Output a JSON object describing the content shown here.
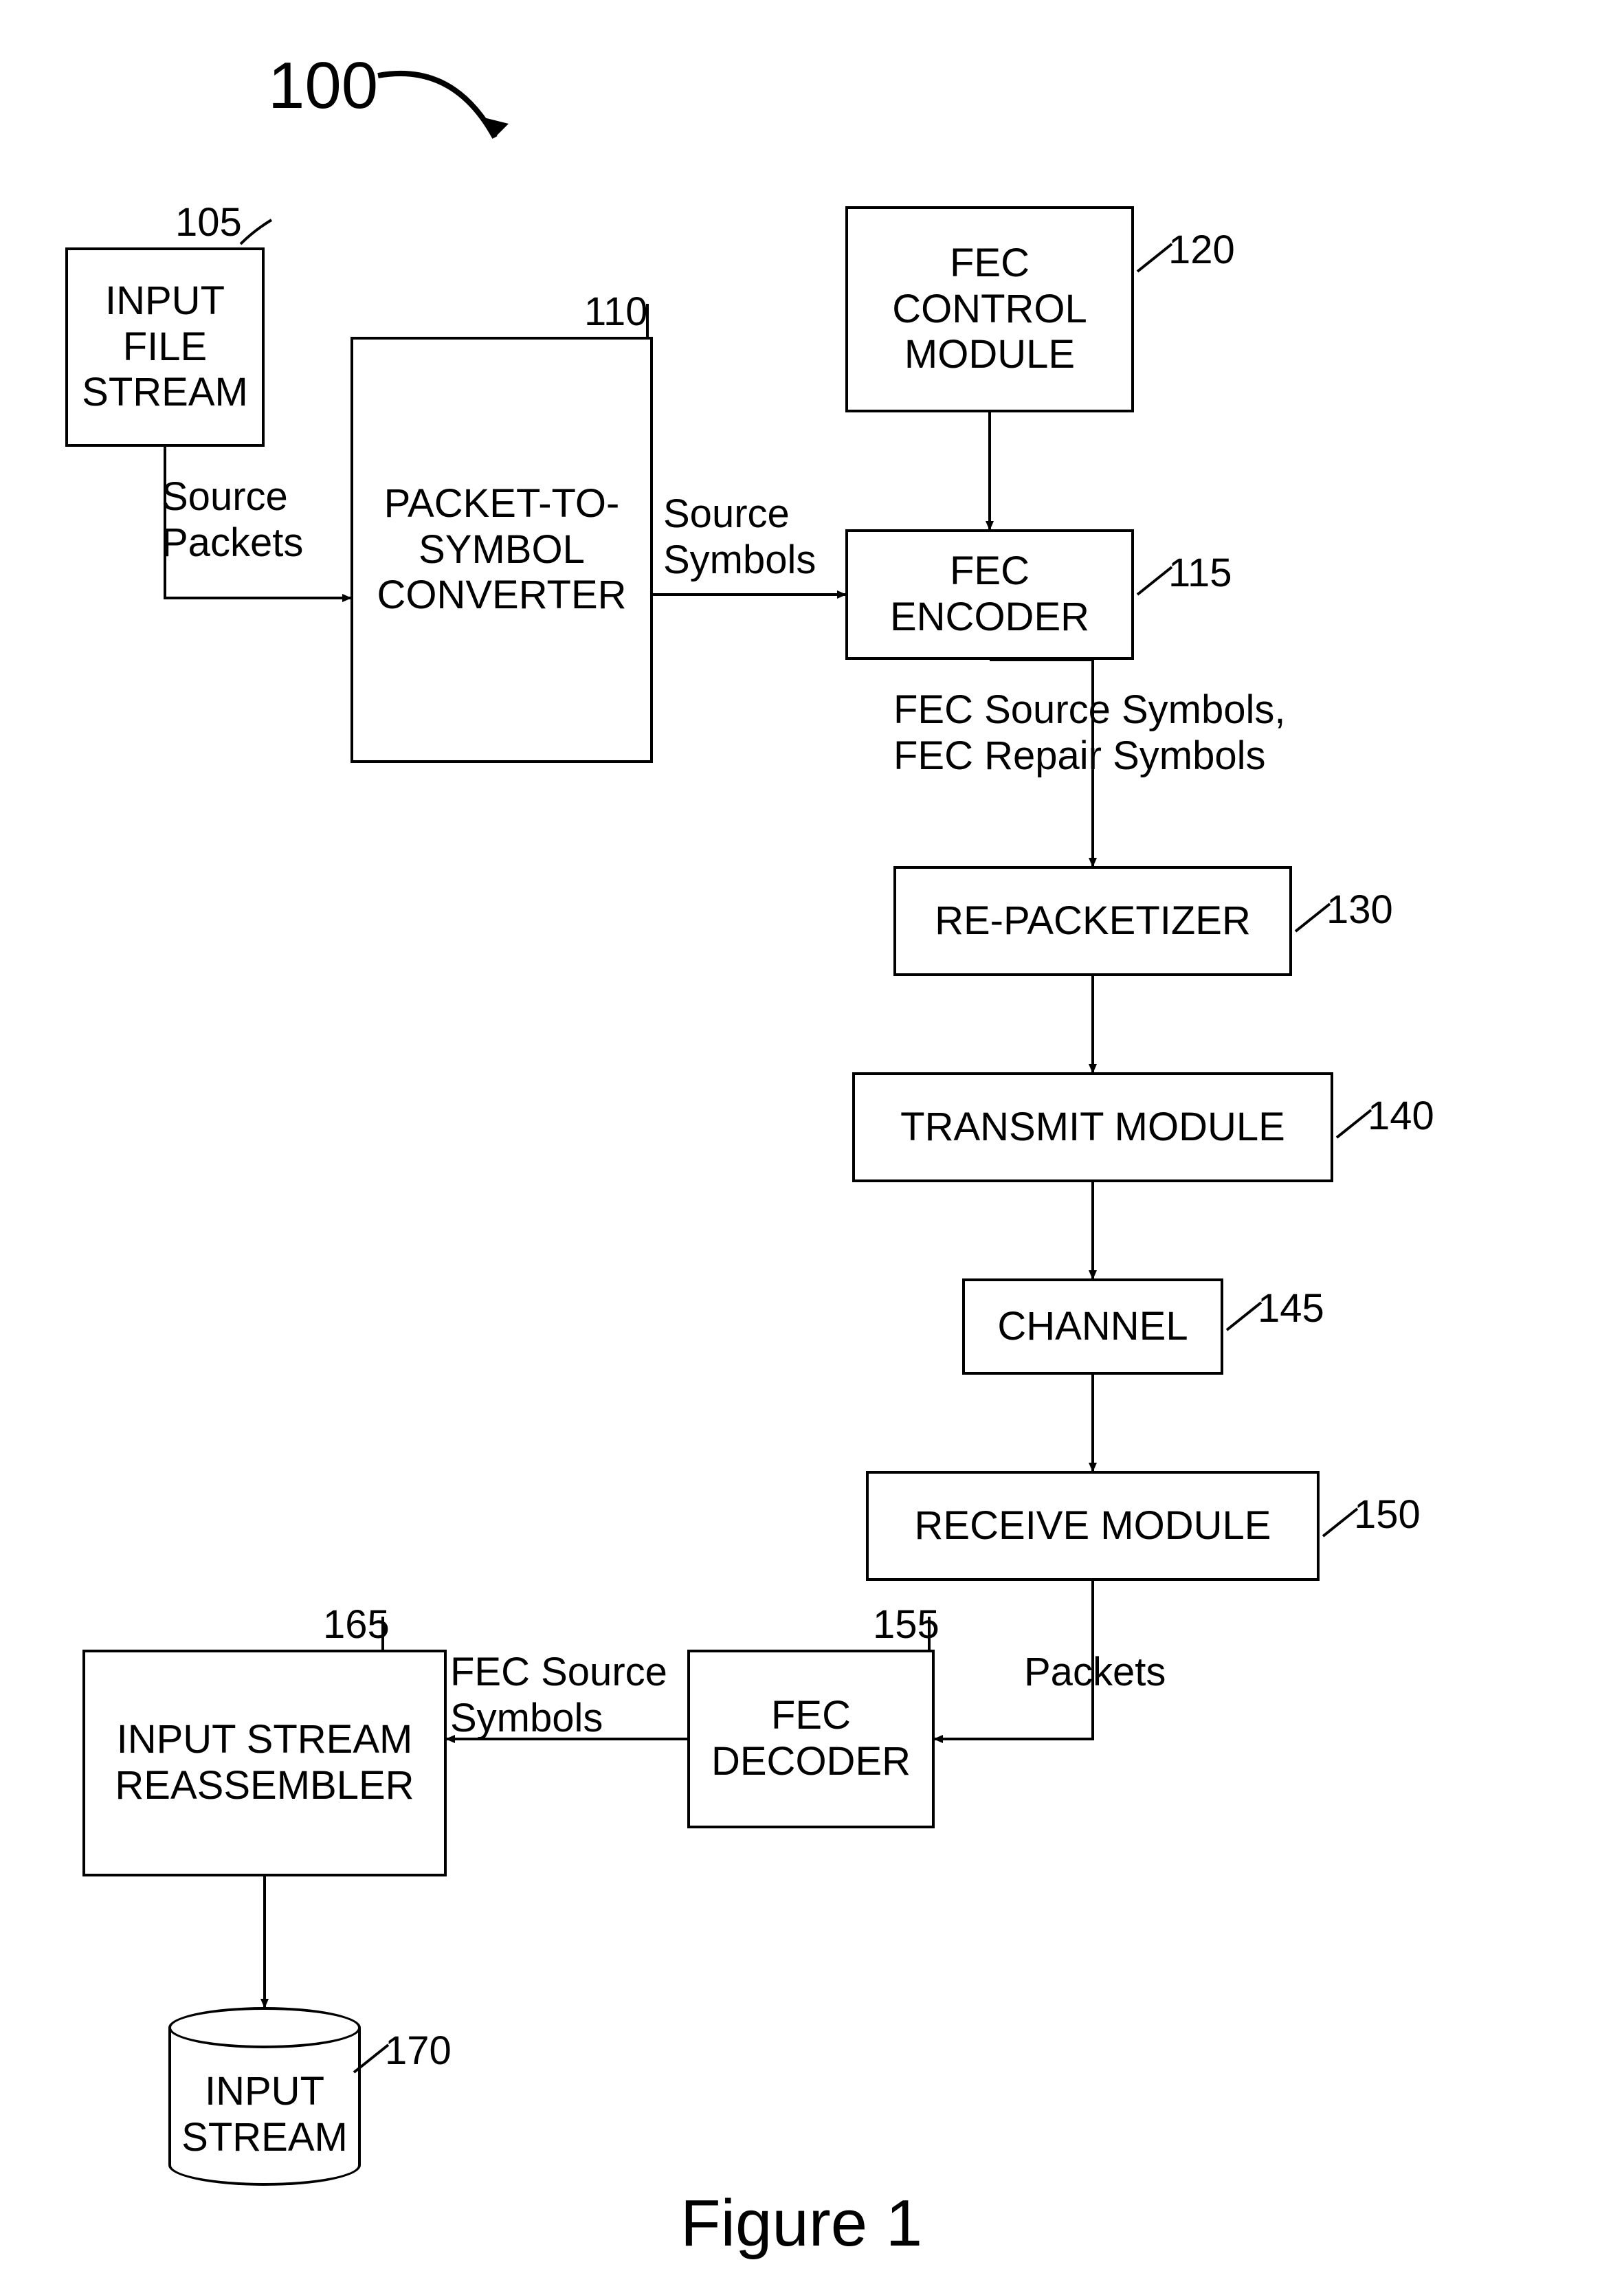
{
  "figure": {
    "number": "100",
    "caption": "Figure 1"
  },
  "blocks": {
    "b105": {
      "label": "INPUT\nFILE\nSTREAM",
      "ref": "105"
    },
    "b110": {
      "label": "PACKET-TO-\nSYMBOL\nCONVERTER",
      "ref": "110"
    },
    "b120": {
      "label": "FEC\nCONTROL\nMODULE",
      "ref": "120"
    },
    "b115": {
      "label": "FEC\nENCODER",
      "ref": "115"
    },
    "b130": {
      "label": "RE-PACKETIZER",
      "ref": "130"
    },
    "b140": {
      "label": "TRANSMIT MODULE",
      "ref": "140"
    },
    "b145": {
      "label": "CHANNEL",
      "ref": "145"
    },
    "b150": {
      "label": "RECEIVE MODULE",
      "ref": "150"
    },
    "b155": {
      "label": "FEC\nDECODER",
      "ref": "155"
    },
    "b165": {
      "label": "INPUT STREAM\nREASSEMBLER",
      "ref": "165"
    },
    "b170": {
      "label": "INPUT\nSTREAM",
      "ref": "170"
    }
  },
  "edges": {
    "sourcePackets": "Source\nPackets",
    "sourceSymbols": "Source\nSymbols",
    "fecSymbols": "FEC Source Symbols,\nFEC Repair Symbols",
    "packets": "Packets",
    "fecSourceSymbols": "FEC Source\nSymbols"
  }
}
